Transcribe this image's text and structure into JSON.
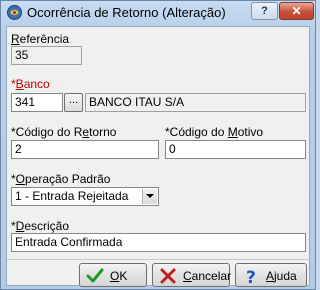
{
  "window": {
    "title": "Ocorrência de Retorno (Alteração)",
    "help_button": "?",
    "close_button": "✕"
  },
  "form": {
    "referencia": {
      "label_first": "R",
      "label_rest": "eferência",
      "value": "35"
    },
    "banco": {
      "label_required": "*",
      "label_first": "B",
      "label_rest": "anco",
      "code": "341",
      "lookup_label": "...",
      "name": "BANCO ITAU S/A"
    },
    "codigo_retorno": {
      "label_pre": "*Código do R",
      "label_accel": "e",
      "label_post": "torno",
      "value": "2"
    },
    "codigo_motivo": {
      "label_pre": "*Código do ",
      "label_accel": "M",
      "label_post": "otivo",
      "value": "0"
    },
    "operacao_padrao": {
      "label_pre": "*",
      "label_accel": "O",
      "label_post": "peração Padrão",
      "selected": "1 - Entrada Rejeitada"
    },
    "descricao": {
      "label_pre": "*",
      "label_accel": "D",
      "label_post": "escrição",
      "value": "Entrada Confirmada"
    }
  },
  "buttons": {
    "ok": {
      "accel": "O",
      "rest": "K"
    },
    "cancelar": {
      "accel": "C",
      "rest": "ancelar"
    },
    "ajuda": {
      "accel": "A",
      "rest": "juda"
    }
  },
  "colors": {
    "required_label": "#c00000",
    "titlebar": "#c7dcf2",
    "close_button": "#c8513a"
  }
}
